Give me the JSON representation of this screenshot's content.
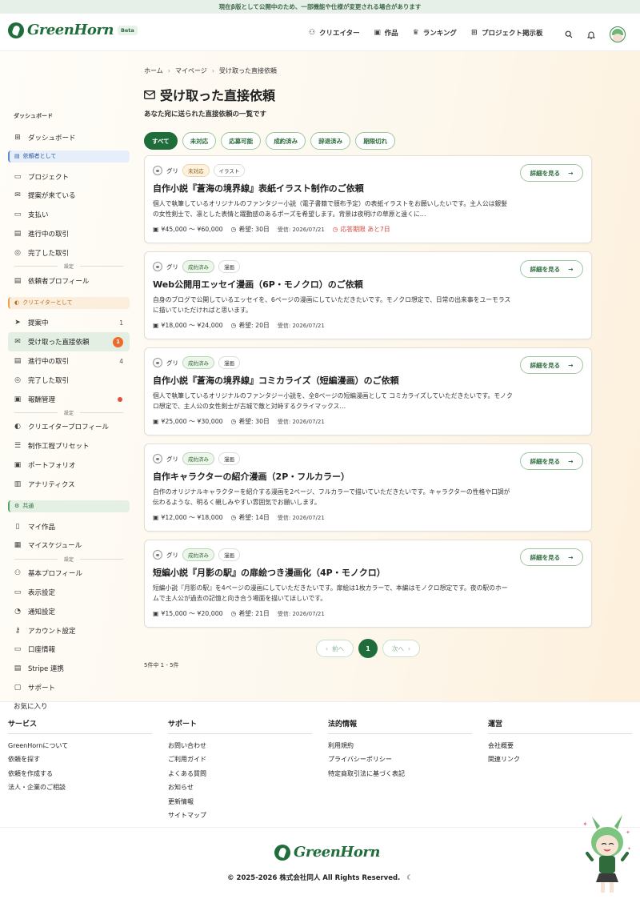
{
  "banner": "現在β版として公開中のため、一部機能や仕様が変更される場合があります",
  "header": {
    "logo_text": "GreenHorn",
    "beta": "Beta",
    "nav": [
      {
        "label": "クリエイター",
        "icon": "people-icon"
      },
      {
        "label": "作品",
        "icon": "image-icon"
      },
      {
        "label": "ランキング",
        "icon": "crown-icon"
      },
      {
        "label": "プロジェクト掲示板",
        "icon": "grid-icon"
      }
    ]
  },
  "sidebar": {
    "dashboard_title": "ダッシュボード",
    "dashboard": "ダッシュボード",
    "client_section": "依頼者として",
    "client_items": [
      "プロジェクト",
      "提案が来ている",
      "支払い",
      "進行中の取引",
      "完了した取引"
    ],
    "settings_label": "設定",
    "client_profile": "依頼者プロフィール",
    "creator_section": "クリエイターとして",
    "creator_items": [
      {
        "label": "提案中",
        "count": "1"
      },
      {
        "label": "受け取った直接依頼",
        "badge": "1"
      },
      {
        "label": "進行中の取引",
        "count": "4"
      },
      {
        "label": "完了した取引"
      },
      {
        "label": "報酬管理"
      }
    ],
    "creator_settings": [
      "クリエイタープロフィール",
      "制作工程プリセット",
      "ポートフォリオ",
      "アナリティクス"
    ],
    "common_section": "共通",
    "common_items": [
      "マイ作品",
      "マイスケジュール"
    ],
    "common_settings": [
      "基本プロフィール",
      "表示設定",
      "通知設定",
      "アカウント設定",
      "口座情報",
      "Stripe 連携",
      "サポート"
    ],
    "favorites": "お気に入り"
  },
  "main": {
    "breadcrumb": [
      "ホーム",
      "マイページ",
      "受け取った直接依頼"
    ],
    "title": "受け取った直接依頼",
    "subtitle": "あなた宛に送られた直接依頼の一覧です",
    "filters": [
      "すべて",
      "未対応",
      "応募可能",
      "成約済み",
      "辞退済み",
      "期限切れ"
    ],
    "detail_label": "詳細を見る",
    "requests": [
      {
        "user": "グリ",
        "status": "未対応",
        "category": "イラスト",
        "title": "自作小説『蒼海の境界線』表紙イラスト制作のご依頼",
        "desc": "個人で執筆しているオリジナルのファンタジー小説（電子書籍で頒布予定）の表紙イラストをお願いしたいです。主人公は銀髪の女性剣士で、凛とした表情と躍動感のあるポーズを希望します。背景は夜明けの草原と遠くに…",
        "budget": "¥45,000 〜 ¥60,000",
        "hope": "希望: 30日",
        "received": "受信: 2026/07/21",
        "deadline": "応答期限 あと7日"
      },
      {
        "user": "グリ",
        "status": "成約済み",
        "category": "漫画",
        "title": "Web公開用エッセイ漫画（6P・モノクロ）のご依頼",
        "desc": "自身のブログで公開しているエッセイを、6ページの漫画にしていただきたいです。モノクロ想定で、日常の出来事をユーモラスに描いていただければと思います。",
        "budget": "¥18,000 〜 ¥24,000",
        "hope": "希望: 20日",
        "received": "受信: 2026/07/21"
      },
      {
        "user": "グリ",
        "status": "成約済み",
        "category": "漫画",
        "title": "自作小説『蒼海の境界線』コミカライズ（短編漫画）のご依頼",
        "desc": "個人で執筆しているオリジナルのファンタジー小説を、全8ページの短編漫画として コミカライズしていただきたいです。モノクロ想定で、主人公の女性剣士が古城で敵と対峙するクライマックス…",
        "budget": "¥25,000 〜 ¥30,000",
        "hope": "希望: 30日",
        "received": "受信: 2026/07/21"
      },
      {
        "user": "グリ",
        "status": "成約済み",
        "category": "漫画",
        "title": "自作キャラクターの紹介漫画（2P・フルカラー）",
        "desc": "自作のオリジナルキャラクターを紹介する漫画を2ページ、フルカラーで描いていただきたいです。キャラクターの性格や口調が伝わるような、明るく親しみやすい雰囲気でお願いします。",
        "budget": "¥12,000 〜 ¥18,000",
        "hope": "希望: 14日",
        "received": "受信: 2026/07/21"
      },
      {
        "user": "グリ",
        "status": "成約済み",
        "category": "漫画",
        "title": "短編小説『月影の駅』の扉絵つき漫画化（4P・モノクロ）",
        "desc": "短編小説『月影の駅』を4ページの漫画にしていただきたいです。扉絵は1枚カラーで、本編はモノクロ想定です。夜の駅のホームで主人公が過去の記憶と向き合う場面を描いてほしいです。",
        "budget": "¥15,000 〜 ¥20,000",
        "hope": "希望: 21日",
        "received": "受信: 2026/07/21"
      }
    ],
    "pager": {
      "prev": "前へ",
      "current": "1",
      "next": "次へ"
    },
    "count": "5件中 1 - 5件"
  },
  "footer": {
    "cols": [
      {
        "title": "サービス",
        "links": [
          "GreenHornについて",
          "依頼を探す",
          "依頼を作成する",
          "法人・企業のご相談"
        ]
      },
      {
        "title": "サポート",
        "links": [
          "お問い合わせ",
          "ご利用ガイド",
          "よくある質問",
          "お知らせ",
          "更新情報",
          "サイトマップ"
        ]
      },
      {
        "title": "法的情報",
        "links": [
          "利用規約",
          "プライバシーポリシー",
          "特定商取引法に基づく表記"
        ]
      },
      {
        "title": "運営",
        "links": [
          "会社概要",
          "関連リンク"
        ]
      }
    ],
    "logo_text": "GreenHorn",
    "copyright": "© 2025-2026 株式会社同人 All Rights Reserved."
  },
  "colors": {
    "brand": "#1f6d3a",
    "accent_orange": "#ee6a2a",
    "deadline_red": "#d4463c"
  }
}
